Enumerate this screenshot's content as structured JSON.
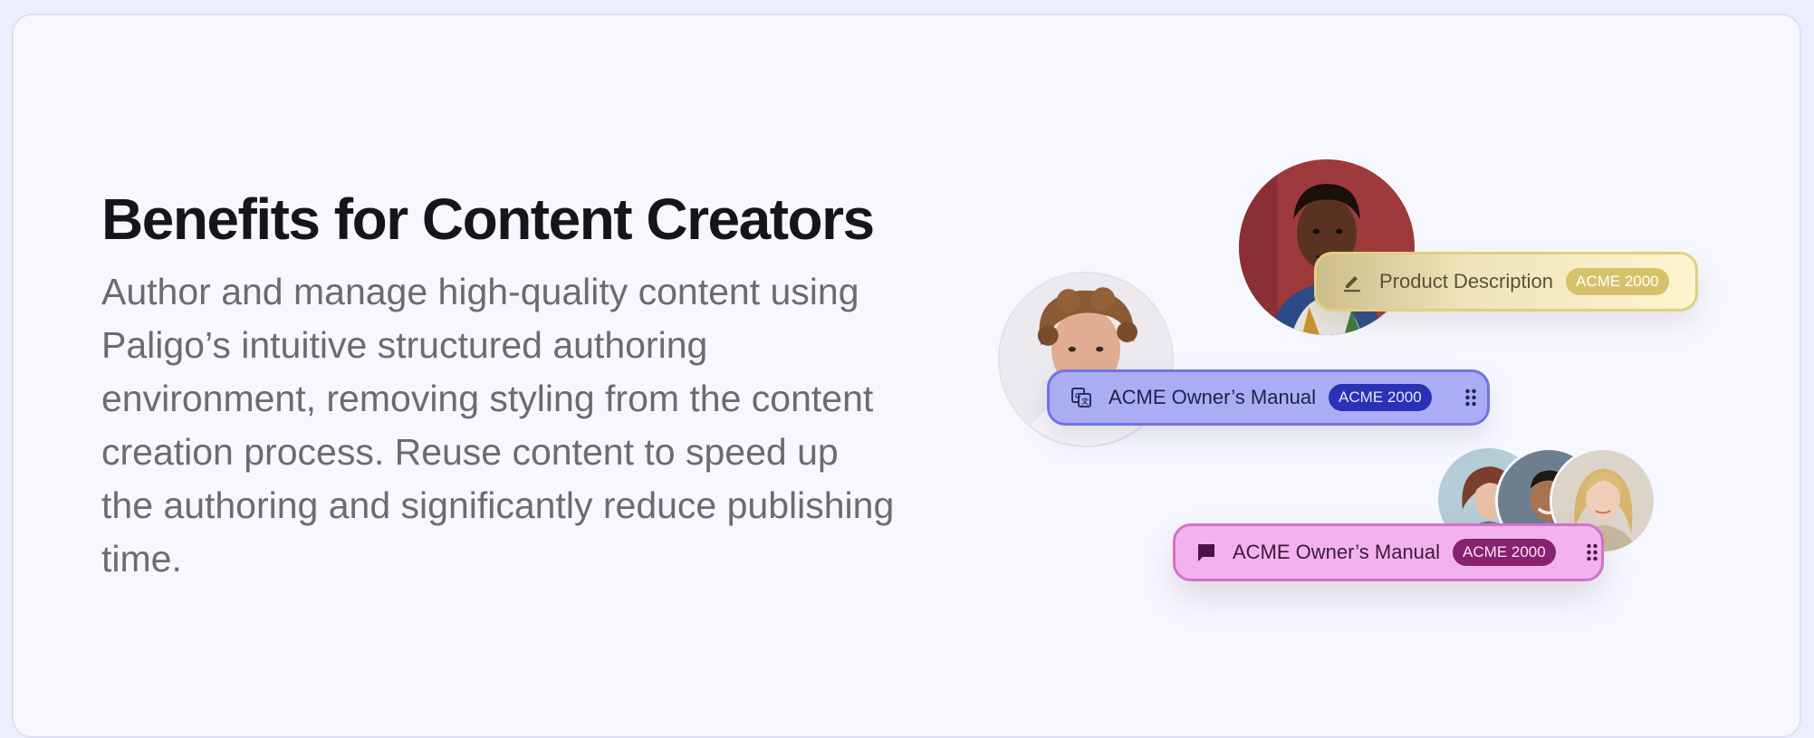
{
  "section": {
    "heading": "Benefits for Content Creators",
    "body": "Author and manage high-quality content using Paligo’s intuitive structured authoring environment, removing styling from the content creation process. Reuse content to speed up the authoring and significantly reduce publishing time."
  },
  "illustration": {
    "cards": [
      {
        "icon": "pencil-icon",
        "label": "Product Description",
        "badge": "ACME 2000",
        "color": "#fcf5cf"
      },
      {
        "icon": "translate-icon",
        "label": "ACME Owner’s Manual",
        "badge": "ACME 2000",
        "handle": "drag-handle-icon",
        "color": "#abadf4"
      },
      {
        "icon": "comment-icon",
        "label": "ACME Owner’s Manual",
        "badge": "ACME 2000",
        "handle": "drag-handle-icon",
        "color": "#f3b2ed"
      }
    ]
  }
}
